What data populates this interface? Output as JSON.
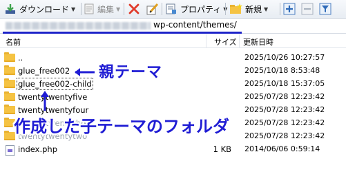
{
  "toolbar": {
    "download_label": "ダウンロード",
    "edit_label": "編集",
    "properties_label": "プロパティ",
    "new_label": "新規"
  },
  "path": {
    "visible_text": "wp-content/themes/"
  },
  "columns": {
    "name": "名前",
    "size": "サイズ",
    "modified": "更新日時"
  },
  "files": [
    {
      "name": "..",
      "size": "",
      "modified": "2025/10/26 10:27:57",
      "icon": "folder-icon"
    },
    {
      "name": "glue_free002",
      "size": "",
      "modified": "2025/10/18 8:53:48",
      "icon": "folder-icon"
    },
    {
      "name": "glue_free002-child",
      "size": "",
      "modified": "2025/10/18 15:37:05",
      "icon": "folder-icon"
    },
    {
      "name": "twentytwentyfive",
      "size": "",
      "modified": "2025/07/28 12:23:42",
      "icon": "folder-icon"
    },
    {
      "name": "twentytwentyfour",
      "size": "",
      "modified": "2025/07/28 12:23:42",
      "icon": "folder-icon"
    },
    {
      "name": "twentytwentythree",
      "size": "",
      "modified": "2025/07/28 12:23:42",
      "icon": "folder-icon"
    },
    {
      "name": "twentytwentytwo",
      "size": "",
      "modified": "2025/07/28 12:23:42",
      "icon": "folder-icon"
    },
    {
      "name": "index.php",
      "size": "1 KB",
      "modified": "2014/06/06 0:59:14",
      "icon": "php-file-icon"
    }
  ],
  "annotations": {
    "parent_theme": "親テーマ",
    "child_theme_caption": "作成した子テーマのフォルダ"
  },
  "colors": {
    "annotation": "#1f1cd4",
    "folder": "#f5c343",
    "delete": "#e03a2a"
  }
}
